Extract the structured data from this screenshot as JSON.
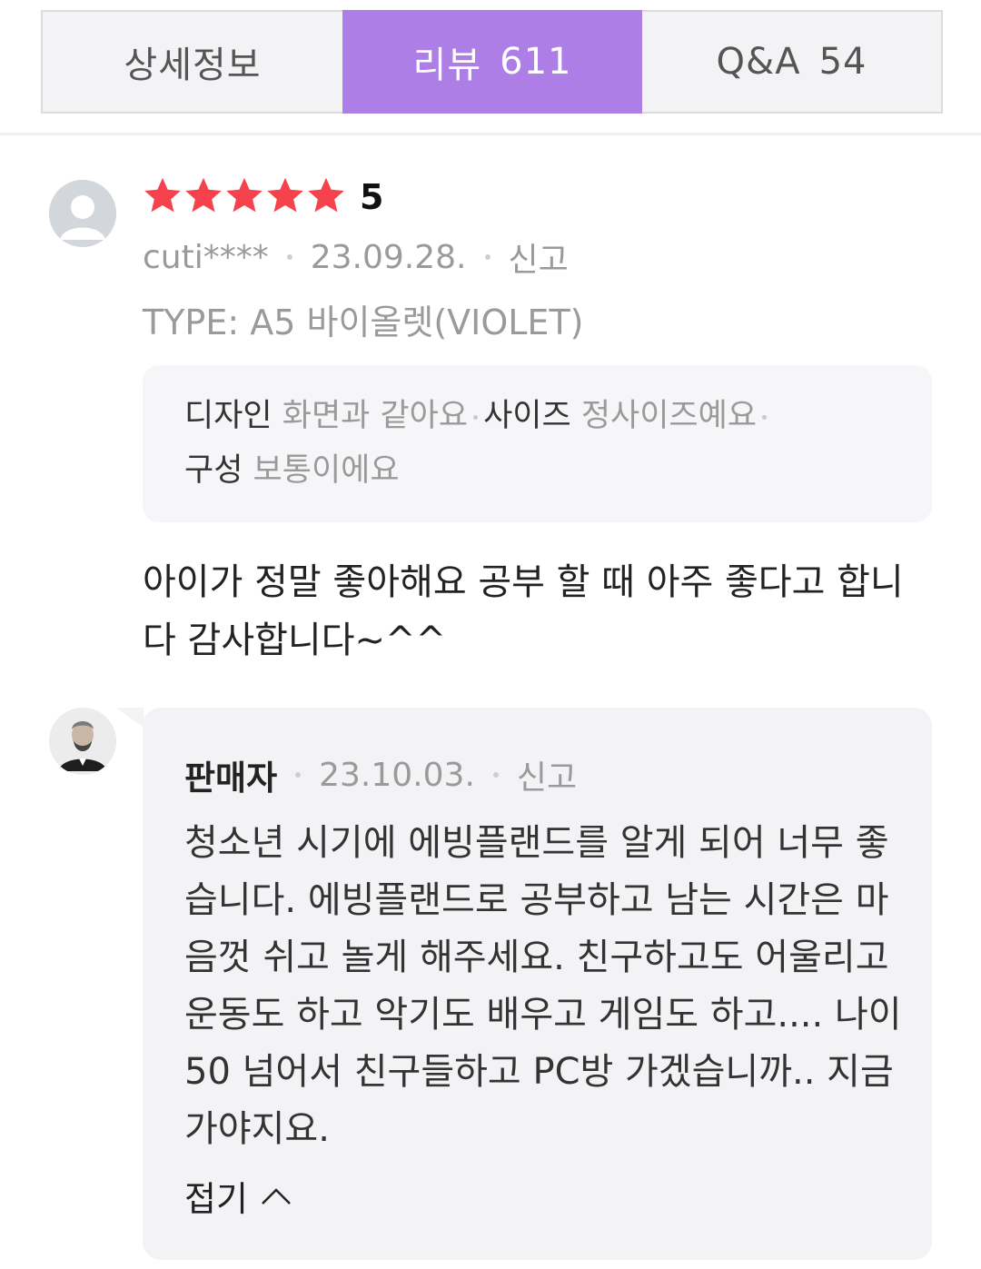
{
  "tabs": [
    {
      "label": "상세정보",
      "count": ""
    },
    {
      "label": "리뷰",
      "count": "611"
    },
    {
      "label": "Q&A",
      "count": "54"
    }
  ],
  "colors": {
    "accent": "#ad7ee6",
    "star": "#f5424c"
  },
  "review": {
    "rating": "5",
    "stars": 5,
    "user": "cuti****",
    "date": "23.09.28.",
    "report": "신고",
    "type": "TYPE: A5 바이올렛(VIOLET)",
    "survey": [
      {
        "key": "디자인",
        "value": "화면과 같아요"
      },
      {
        "key": "사이즈",
        "value": "정사이즈예요"
      },
      {
        "key": "구성",
        "value": "보통이에요"
      }
    ],
    "body": "아이가 정말 좋아해요 공부 할 때 아주 좋다고 합니다 감사합니다~^^"
  },
  "reply": {
    "author": "판매자",
    "date": "23.10.03.",
    "report": "신고",
    "body": "청소년 시기에 에빙플랜드를 알게 되어 너무 좋습니다. 에빙플랜드로 공부하고 남는 시간은 마음껏 쉬고 놀게 해주세요. 친구하고도 어울리고 운동도 하고 악기도 배우고 게임도 하고.... 나이 50 넘어서 친구들하고 PC방 가겠습니까.. 지금 가야지요.",
    "fold_label": "접기"
  },
  "icons": [
    "default-avatar-icon",
    "star-icon",
    "seller-avatar-icon",
    "chevron-up-icon"
  ]
}
